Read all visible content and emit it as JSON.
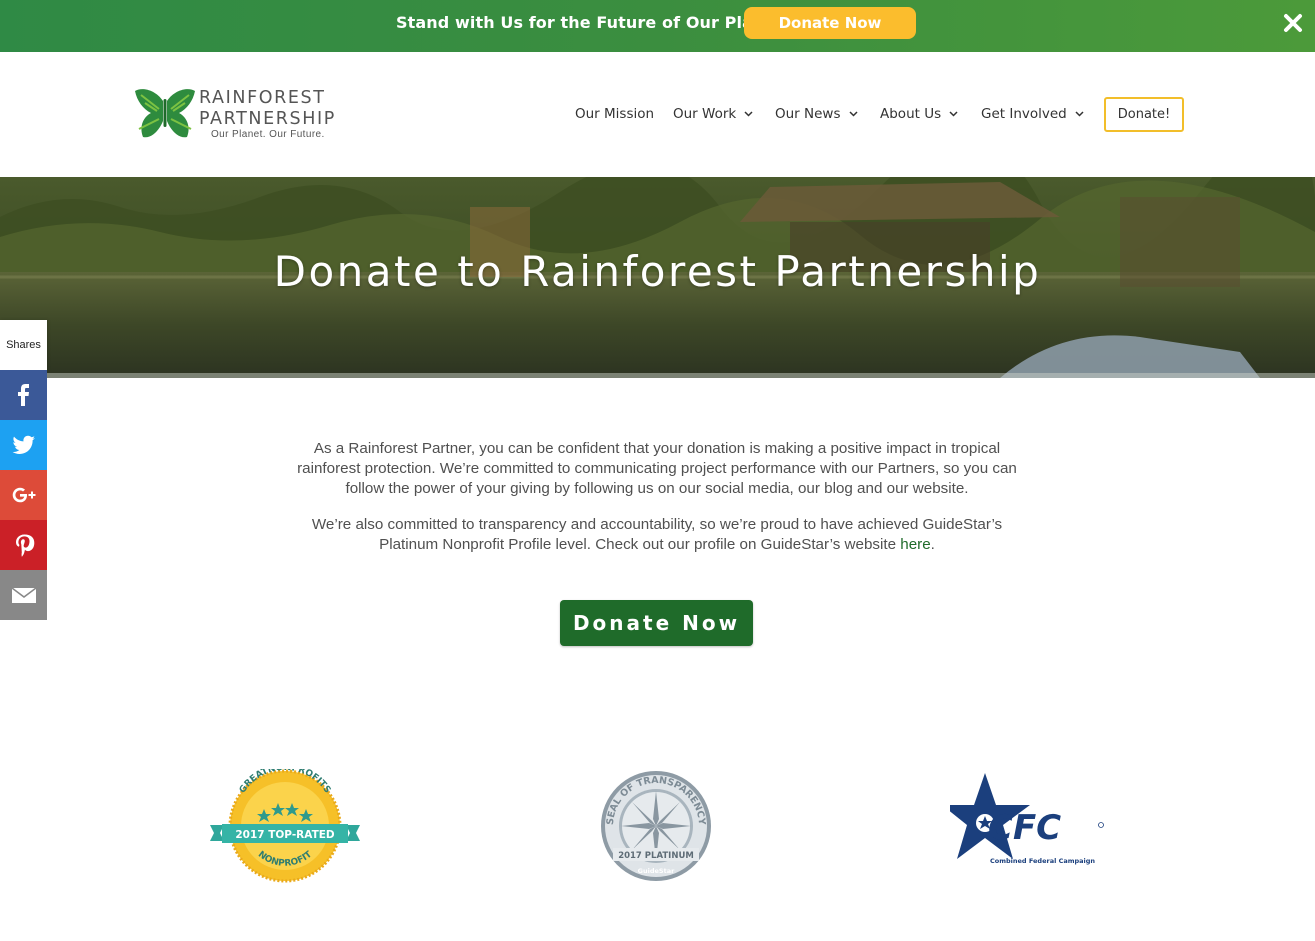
{
  "banner": {
    "text": "Stand with Us for the Future of Our Planet",
    "button_label": "Donate Now",
    "close_icon": "close-icon",
    "bg_color": "#3b8e3f",
    "button_color": "#fbbd2d"
  },
  "header": {
    "logo": {
      "name_line1": "RAINFOREST",
      "name_line2": "PARTNERSHIP",
      "tagline": "Our Planet. Our Future."
    },
    "nav": [
      {
        "label": "Our Mission",
        "has_dropdown": false
      },
      {
        "label": "Our Work",
        "has_dropdown": true
      },
      {
        "label": "Our News",
        "has_dropdown": true
      },
      {
        "label": "About Us",
        "has_dropdown": true
      },
      {
        "label": "Get Involved",
        "has_dropdown": true
      }
    ],
    "donate_label": "Donate!",
    "donate_border_color": "#f2be2a"
  },
  "hero": {
    "title": "Donate to Rainforest Partnership"
  },
  "share": {
    "label": "Shares",
    "buttons": [
      {
        "icon": "facebook-icon",
        "color": "#3b5998"
      },
      {
        "icon": "twitter-icon",
        "color": "#1da1f2"
      },
      {
        "icon": "google-plus-icon",
        "color": "#dd4b39"
      },
      {
        "icon": "pinterest-icon",
        "color": "#cb2027"
      },
      {
        "icon": "email-icon",
        "color": "#888888"
      }
    ]
  },
  "content": {
    "para1_line1": "As a Rainforest Partner, you can be confident that your donation is making a positive impact in tropical",
    "para1_line2": "rainforest protection. We’re committed to communicating project performance with our Partners, so you can",
    "para1_line3": "follow the power of your giving by following us on our social media, our blog and our website.",
    "para2_line1": "We’re also committed to transparency and accountability, so we’re proud to have achieved GuideStar’s",
    "para2_line2": "Platinum Nonprofit Profile level. Check out our profile on GuideStar’s website ",
    "para2_link": "here",
    "para2_end": ".",
    "donate_button": "Donate Now",
    "accent_color": "#1f6b2a"
  },
  "badges": {
    "great_nonprofits": {
      "arc": "GREATNONPROFITS",
      "ribbon": "2017 TOP-RATED",
      "bottom": "NONPROFIT"
    },
    "guidestar": {
      "arc": "SEAL OF TRANSPARENCY",
      "level": "2017 PLATINUM",
      "brand": "GuideStar"
    },
    "cfc": {
      "mark": "CFC",
      "name": "Combined Federal Campaign"
    }
  }
}
